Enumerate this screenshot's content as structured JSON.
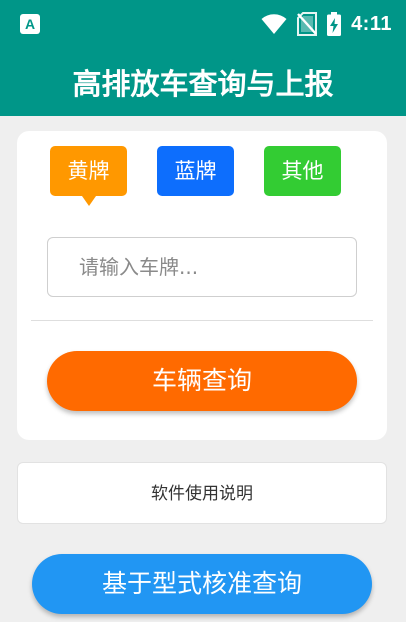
{
  "status_bar": {
    "app_badge": "A",
    "time": "4:11",
    "icons": [
      "wifi-icon",
      "no-sim-icon",
      "battery-charging-icon"
    ]
  },
  "app_bar": {
    "title": "高排放车查询与上报"
  },
  "plate_types": {
    "yellow": "黄牌",
    "blue": "蓝牌",
    "other": "其他",
    "selected": "黄牌"
  },
  "search": {
    "placeholder": "请输入车牌...",
    "value": ""
  },
  "actions": {
    "vehicle_query": "车辆查询",
    "manual": "软件使用说明",
    "type_approval_query": "基于型式核准查询"
  },
  "colors": {
    "primary": "#009688",
    "yellow_plate": "#ff9800",
    "blue_plate": "#0d6efd",
    "other_plate": "#33cc33",
    "query_button": "#ff6a00",
    "type_button": "#2196f3"
  }
}
